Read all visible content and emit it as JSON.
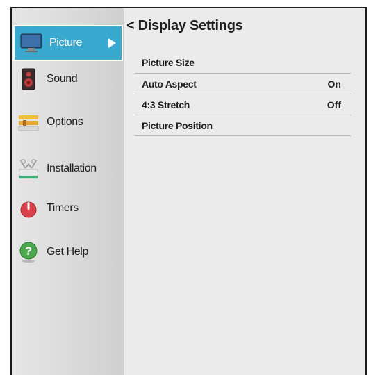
{
  "sidebar": {
    "items": [
      {
        "label": "Picture",
        "icon": "monitor-icon",
        "active": true
      },
      {
        "label": "Sound",
        "icon": "speaker-icon"
      },
      {
        "label": "Options",
        "icon": "options-icon"
      },
      {
        "label": "Installation",
        "icon": "antenna-icon"
      },
      {
        "label": "Timers",
        "icon": "power-timer-icon"
      },
      {
        "label": "Get Help",
        "icon": "help-icon"
      }
    ]
  },
  "panel": {
    "back_symbol": "<",
    "title": "Display Settings",
    "rows": [
      {
        "label": "Picture Size",
        "value": ""
      },
      {
        "label": "Auto Aspect",
        "value": "On"
      },
      {
        "label": "4:3 Stretch",
        "value": "Off"
      },
      {
        "label": "Picture Position",
        "value": ""
      }
    ]
  },
  "colors": {
    "accent": "#3aa9cf",
    "background": "#ebebeb"
  }
}
